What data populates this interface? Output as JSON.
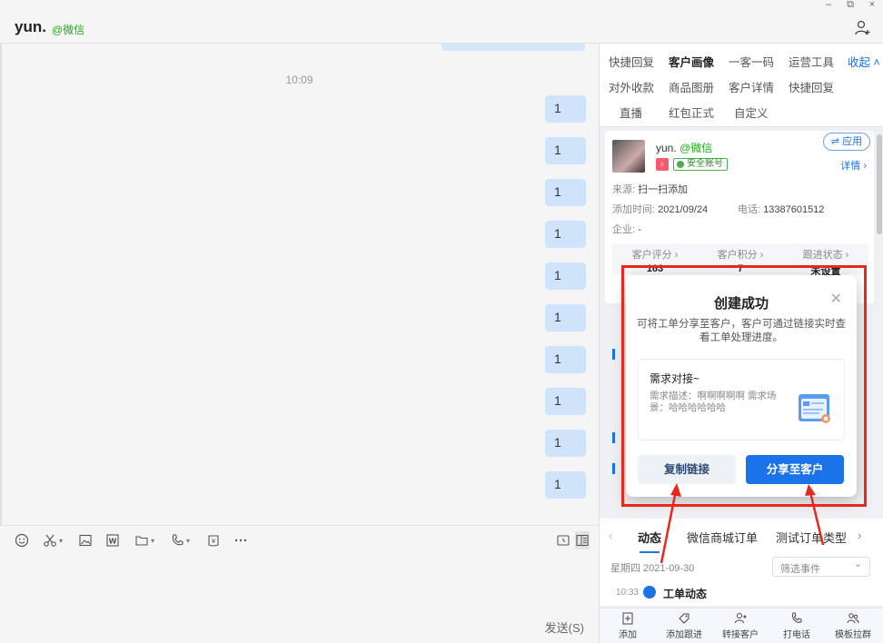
{
  "header": {
    "name": "yun.",
    "source_tag": "@微信"
  },
  "window": {
    "minimize": "–",
    "restore": "⧉",
    "close": "×"
  },
  "chat": {
    "time": "10:09",
    "messages": [
      "1",
      "1",
      "1",
      "1",
      "1",
      "1",
      "1",
      "1",
      "1",
      "1"
    ]
  },
  "input": {
    "send_label": "发送(S)"
  },
  "panel": {
    "tabs_row1": [
      "快捷回复",
      "客户画像",
      "一客一码",
      "运营工具"
    ],
    "collapse_label": "收起 ˄",
    "tabs_row2": [
      "对外收款",
      "商品图册",
      "客户详情",
      "快捷回复"
    ],
    "tabs_row3": [
      "直播",
      "红包正式",
      "自定义"
    ],
    "customer": {
      "name": "yun.",
      "name_tag": "@微信",
      "gender_icon": "female-icon",
      "safe_label": "安全账号",
      "apply_label": "⇌ 应用",
      "detail_label": "详情 ›",
      "source_label": "来源:",
      "source_value": "扫一扫添加",
      "added_label": "添加时间:",
      "added_value": "2021/09/24",
      "phone_label": "电话:",
      "phone_value": "13387601512",
      "company_label": "企业:",
      "company_value": "-",
      "stats": [
        {
          "label": "客户评分 ›",
          "value": "163"
        },
        {
          "label": "客户积分 ›",
          "value": "7"
        },
        {
          "label": "跟进状态 ›",
          "value": "未设置"
        }
      ]
    },
    "subtabs": [
      "动态",
      "微信商城订单",
      "测试订单类型"
    ],
    "date": "星期四  2021-09-30",
    "filter_placeholder": "筛选事件",
    "event_time": "10:33",
    "event_title": "工单动态",
    "bottom_actions": [
      "添加",
      "添加跟进",
      "转接客户",
      "打电话",
      "模板拉群"
    ]
  },
  "dialog": {
    "title": "创建成功",
    "description": "可将工单分享至客户，客户可通过链接实时查看工单处理进度。",
    "item_title": "需求对接~",
    "item_desc": "需求描述：啊啊啊啊啊 需求场景：哈哈哈哈哈哈",
    "copy_label": "复制链接",
    "share_label": "分享至客户"
  },
  "colors": {
    "accent": "#1a73e8",
    "annotation": "#e8281c",
    "bubble": "#cfe4fb",
    "wechat_green": "#1aad19"
  }
}
